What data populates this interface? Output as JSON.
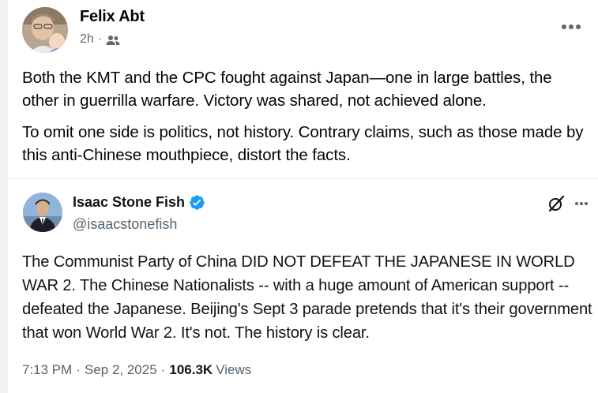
{
  "post": {
    "author": "Felix Abt",
    "time": "2h",
    "separator": "·",
    "audience_icon": "friends-icon",
    "more_icon": "more-horizontal-icon",
    "paragraphs": [
      "Both the KMT and the CPC fought against Japan—one in large battles, the other in guerrilla warfare. Victory was shared, not achieved alone.",
      "To omit one side is politics, not history. Contrary claims, such as those made by this anti-Chinese mouthpiece, distort the facts."
    ]
  },
  "tweet": {
    "name": "Isaac Stone Fish",
    "handle": "@isaacstonefish",
    "verified_icon": "verified-badge-icon",
    "grok_icon": "grok-icon",
    "more_icon": "more-horizontal-icon",
    "text": "The Communist Party of China DID NOT DEFEAT THE JAPANESE IN WORLD WAR 2. The Chinese Nationalists -- with a huge amount of American support -- defeated the Japanese. Beijing's Sept 3 parade pretends that it's their government that won World War 2. It's not. The history is clear.",
    "time": "7:13 PM",
    "separator": "·",
    "date": "Sep 2, 2025",
    "views_count": "106.3K",
    "views_label": "Views"
  },
  "colors": {
    "text_primary": "#050505",
    "text_secondary": "#65676b",
    "tweet_text": "#0f1419",
    "tweet_secondary": "#536471",
    "verified_blue": "#1d9bf0"
  }
}
